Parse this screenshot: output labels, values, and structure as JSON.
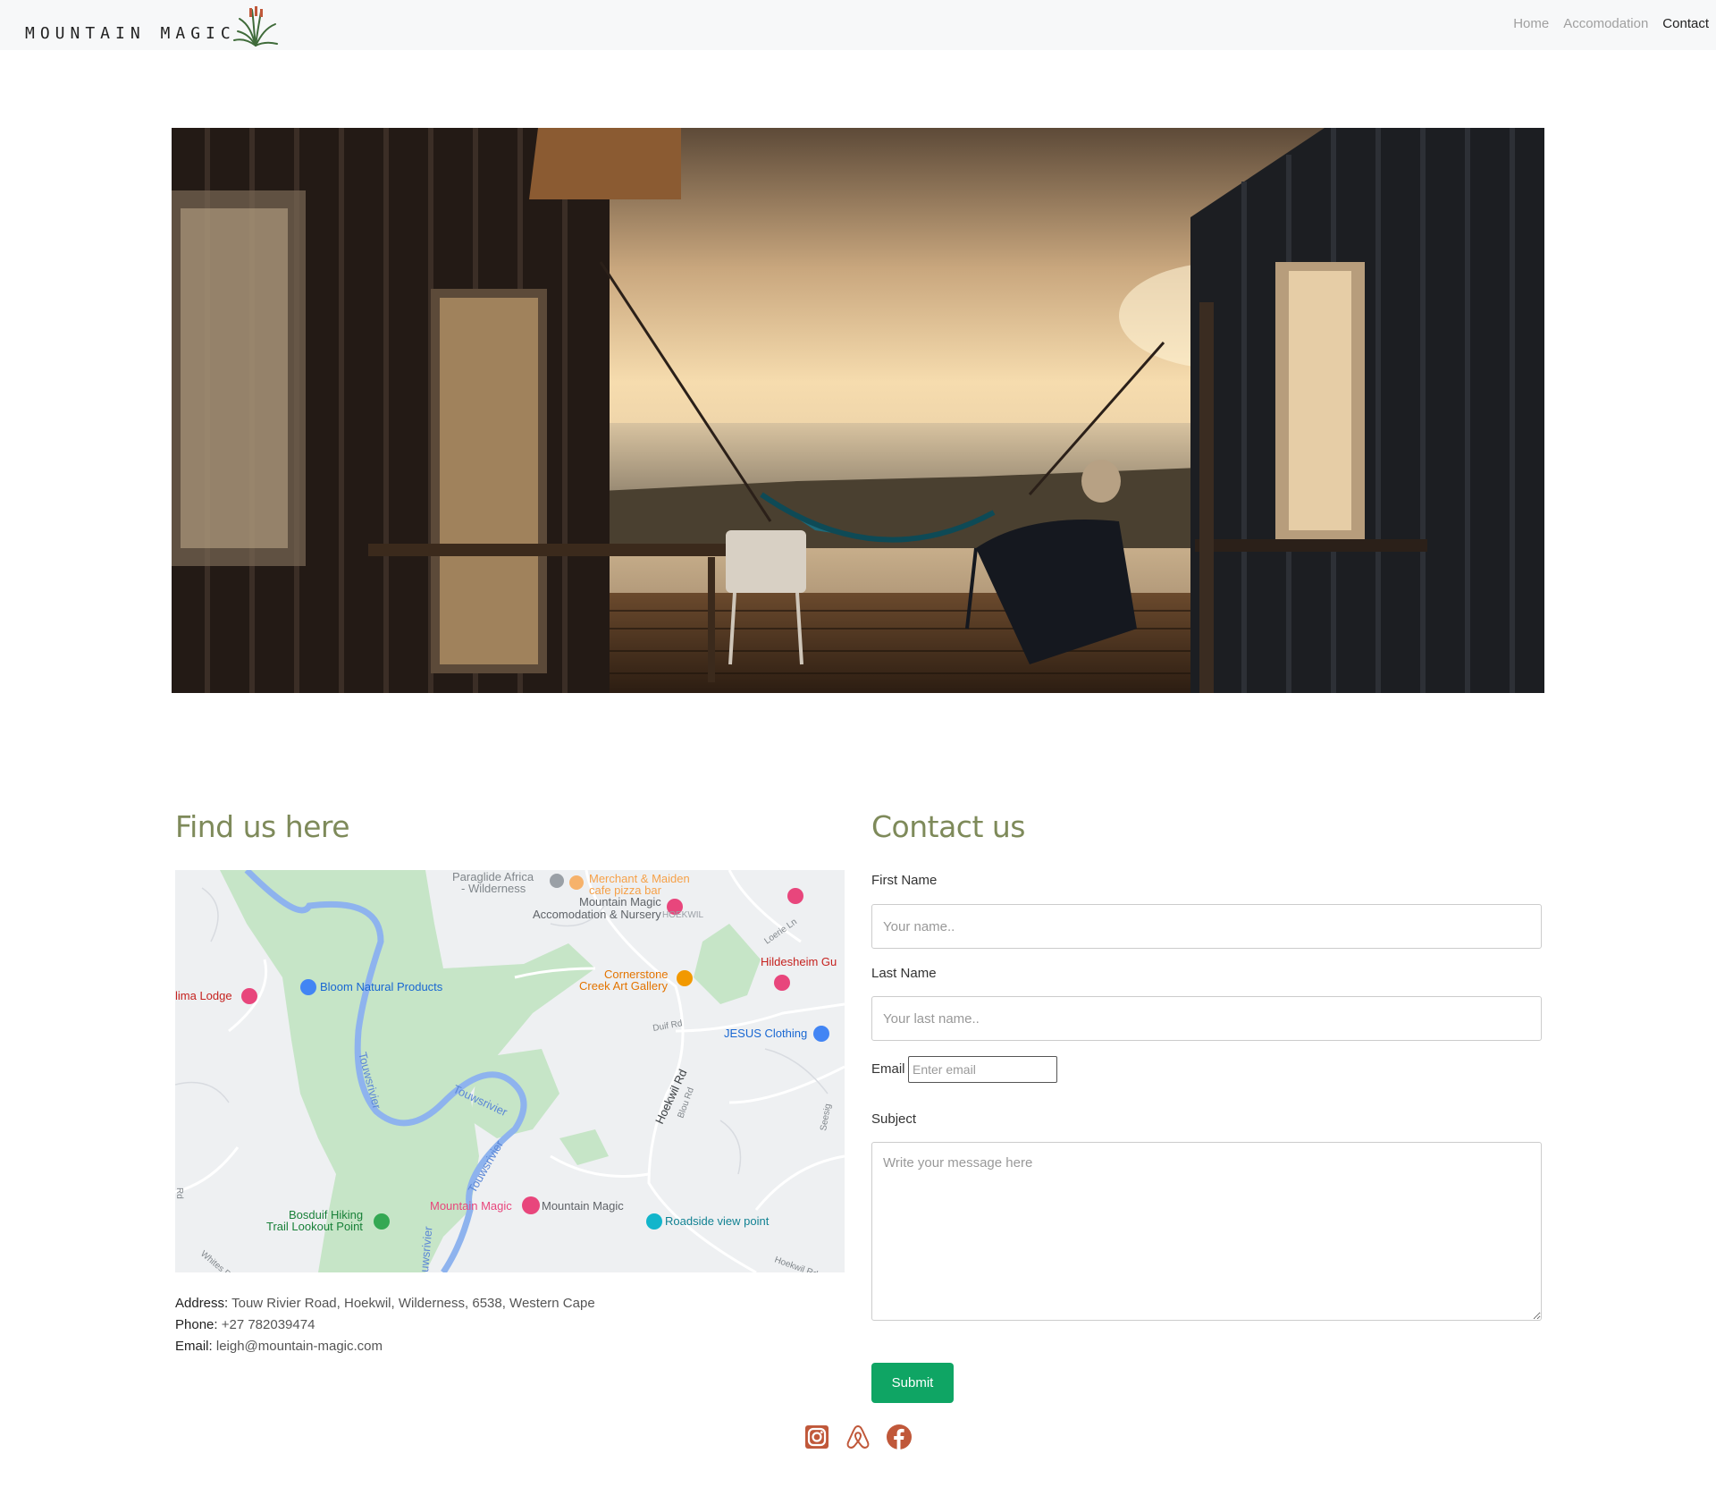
{
  "nav": {
    "logo_text": "MOUNTAIN MAGIC",
    "links": [
      {
        "label": "Home",
        "active": false
      },
      {
        "label": "Accomodation",
        "active": false
      },
      {
        "label": "Contact",
        "active": true
      }
    ]
  },
  "hero": {
    "alt_icon": "hero-photo-cabin-deck-sunset"
  },
  "find": {
    "title": "Find us here",
    "map_labels": {
      "paraglide": "Paraglide Africa",
      "paraglide2": "- Wilderness",
      "merchant": "Merchant & Maiden",
      "merchant2": "cafe pizza bar",
      "mm_acc": "Mountain Magic",
      "mm_acc2": "Accomodation & Nursery",
      "hoekwil": "HOEKWIL",
      "corner": "Cornerstone",
      "corner2": "Creek Art Gallery",
      "hildesheim": "Hildesheim Gu",
      "lodge": "lima Lodge",
      "bloom": "Bloom Natural Products",
      "jesus": "JESUS Clothing",
      "touws1": "Touwsrivier",
      "touws2": "Touwsrivier",
      "touws3": "Touwsrivier",
      "touws4": "uwsrivier",
      "duif": "Duif Rd",
      "hoekwil_rd": "Hoekwil Rd",
      "blou": "Blou Rd",
      "loerie": "Loerie Ln",
      "seesig": "Seesig",
      "bosduif": "Bosduif Hiking",
      "bosduif2": "Trail Lookout Point",
      "mm_red": "Mountain Magic",
      "mm_grey": "Mountain Magic",
      "roadside": "Roadside view point",
      "whites": "Whites P",
      "hoekwil_rd2": "Hoekwil Rd",
      "rd_side": "Rd"
    },
    "address_label": "Address:",
    "address_value": " Touw Rivier Road, Hoekwil, Wilderness, 6538, Western Cape",
    "phone_label": "Phone:",
    "phone_value": " +27 782039474",
    "email_label": "Email:",
    "email_value": " leigh@mountain-magic.com"
  },
  "contact": {
    "title": "Contact us",
    "first_name_label": "First Name",
    "first_name_placeholder": "Your name..",
    "last_name_label": "Last Name",
    "last_name_placeholder": "Your last name..",
    "email_label": "Email",
    "email_placeholder": "Enter email",
    "subject_label": "Subject",
    "message_placeholder": "Write your message here",
    "submit_label": "Submit"
  },
  "social": {
    "icons": [
      "instagram-icon",
      "airbnb-icon",
      "facebook-icon"
    ],
    "color": "#c0583a"
  },
  "colors": {
    "heading": "#7e8a5a",
    "submit": "#0fa564",
    "navbar_bg": "#f7f8f9"
  }
}
